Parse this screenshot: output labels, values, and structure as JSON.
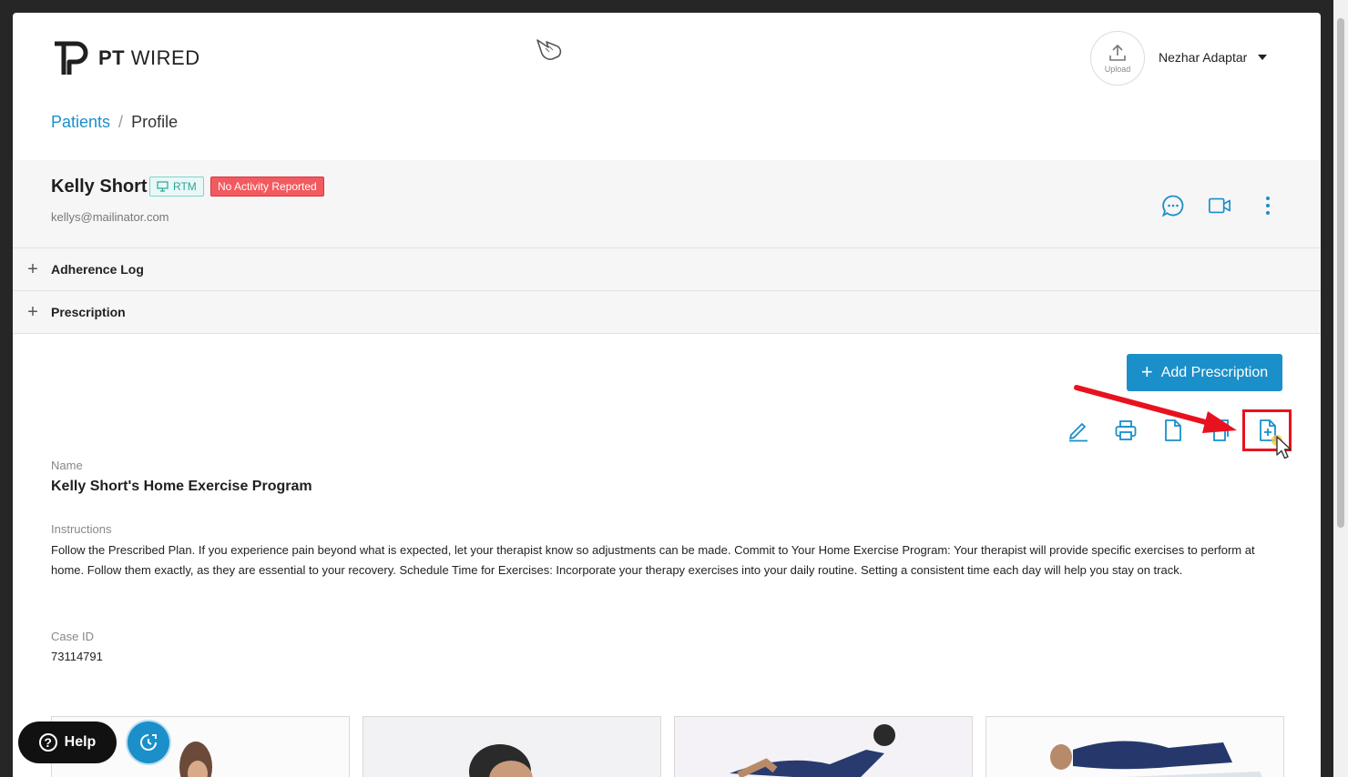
{
  "brand": {
    "logo_prefix": "PT",
    "logo_suffix": "WIRED"
  },
  "header": {
    "upload_label": "Upload",
    "user_name": "Nezhar Adaptar"
  },
  "breadcrumb": {
    "parent": "Patients",
    "separator": "/",
    "current": "Profile"
  },
  "patient": {
    "name": "Kelly Short",
    "rtm_badge": "RTM",
    "status_badge": "No Activity Reported",
    "email": "kellys@mailinator.com"
  },
  "panels": {
    "adherence_log": "Adherence Log",
    "prescription": "Prescription"
  },
  "actions": {
    "add_prescription": "Add Prescription",
    "icons": [
      "edit-icon",
      "print-icon",
      "document-icon",
      "copy-icon",
      "add-document-icon"
    ]
  },
  "prescription": {
    "name_label": "Name",
    "name_value": "Kelly Short's Home Exercise Program",
    "instructions_label": "Instructions",
    "instructions_value": "Follow the Prescribed Plan. If you experience pain beyond what is expected, let your therapist know so adjustments can be made. Commit to Your Home Exercise Program: Your therapist will provide specific exercises to perform at home. Follow them exactly, as they are essential to your recovery. Schedule Time for Exercises: Incorporate your therapy exercises into your daily routine. Setting a consistent time each day will help you stay on track.",
    "case_id_label": "Case ID",
    "case_id_value": "73114791"
  },
  "help": {
    "label": "Help"
  },
  "colors": {
    "accent": "#1a8fc9",
    "danger_badge": "#f25a5f",
    "rtm_badge": "#2ba597",
    "annotation_red": "#e8121e"
  }
}
